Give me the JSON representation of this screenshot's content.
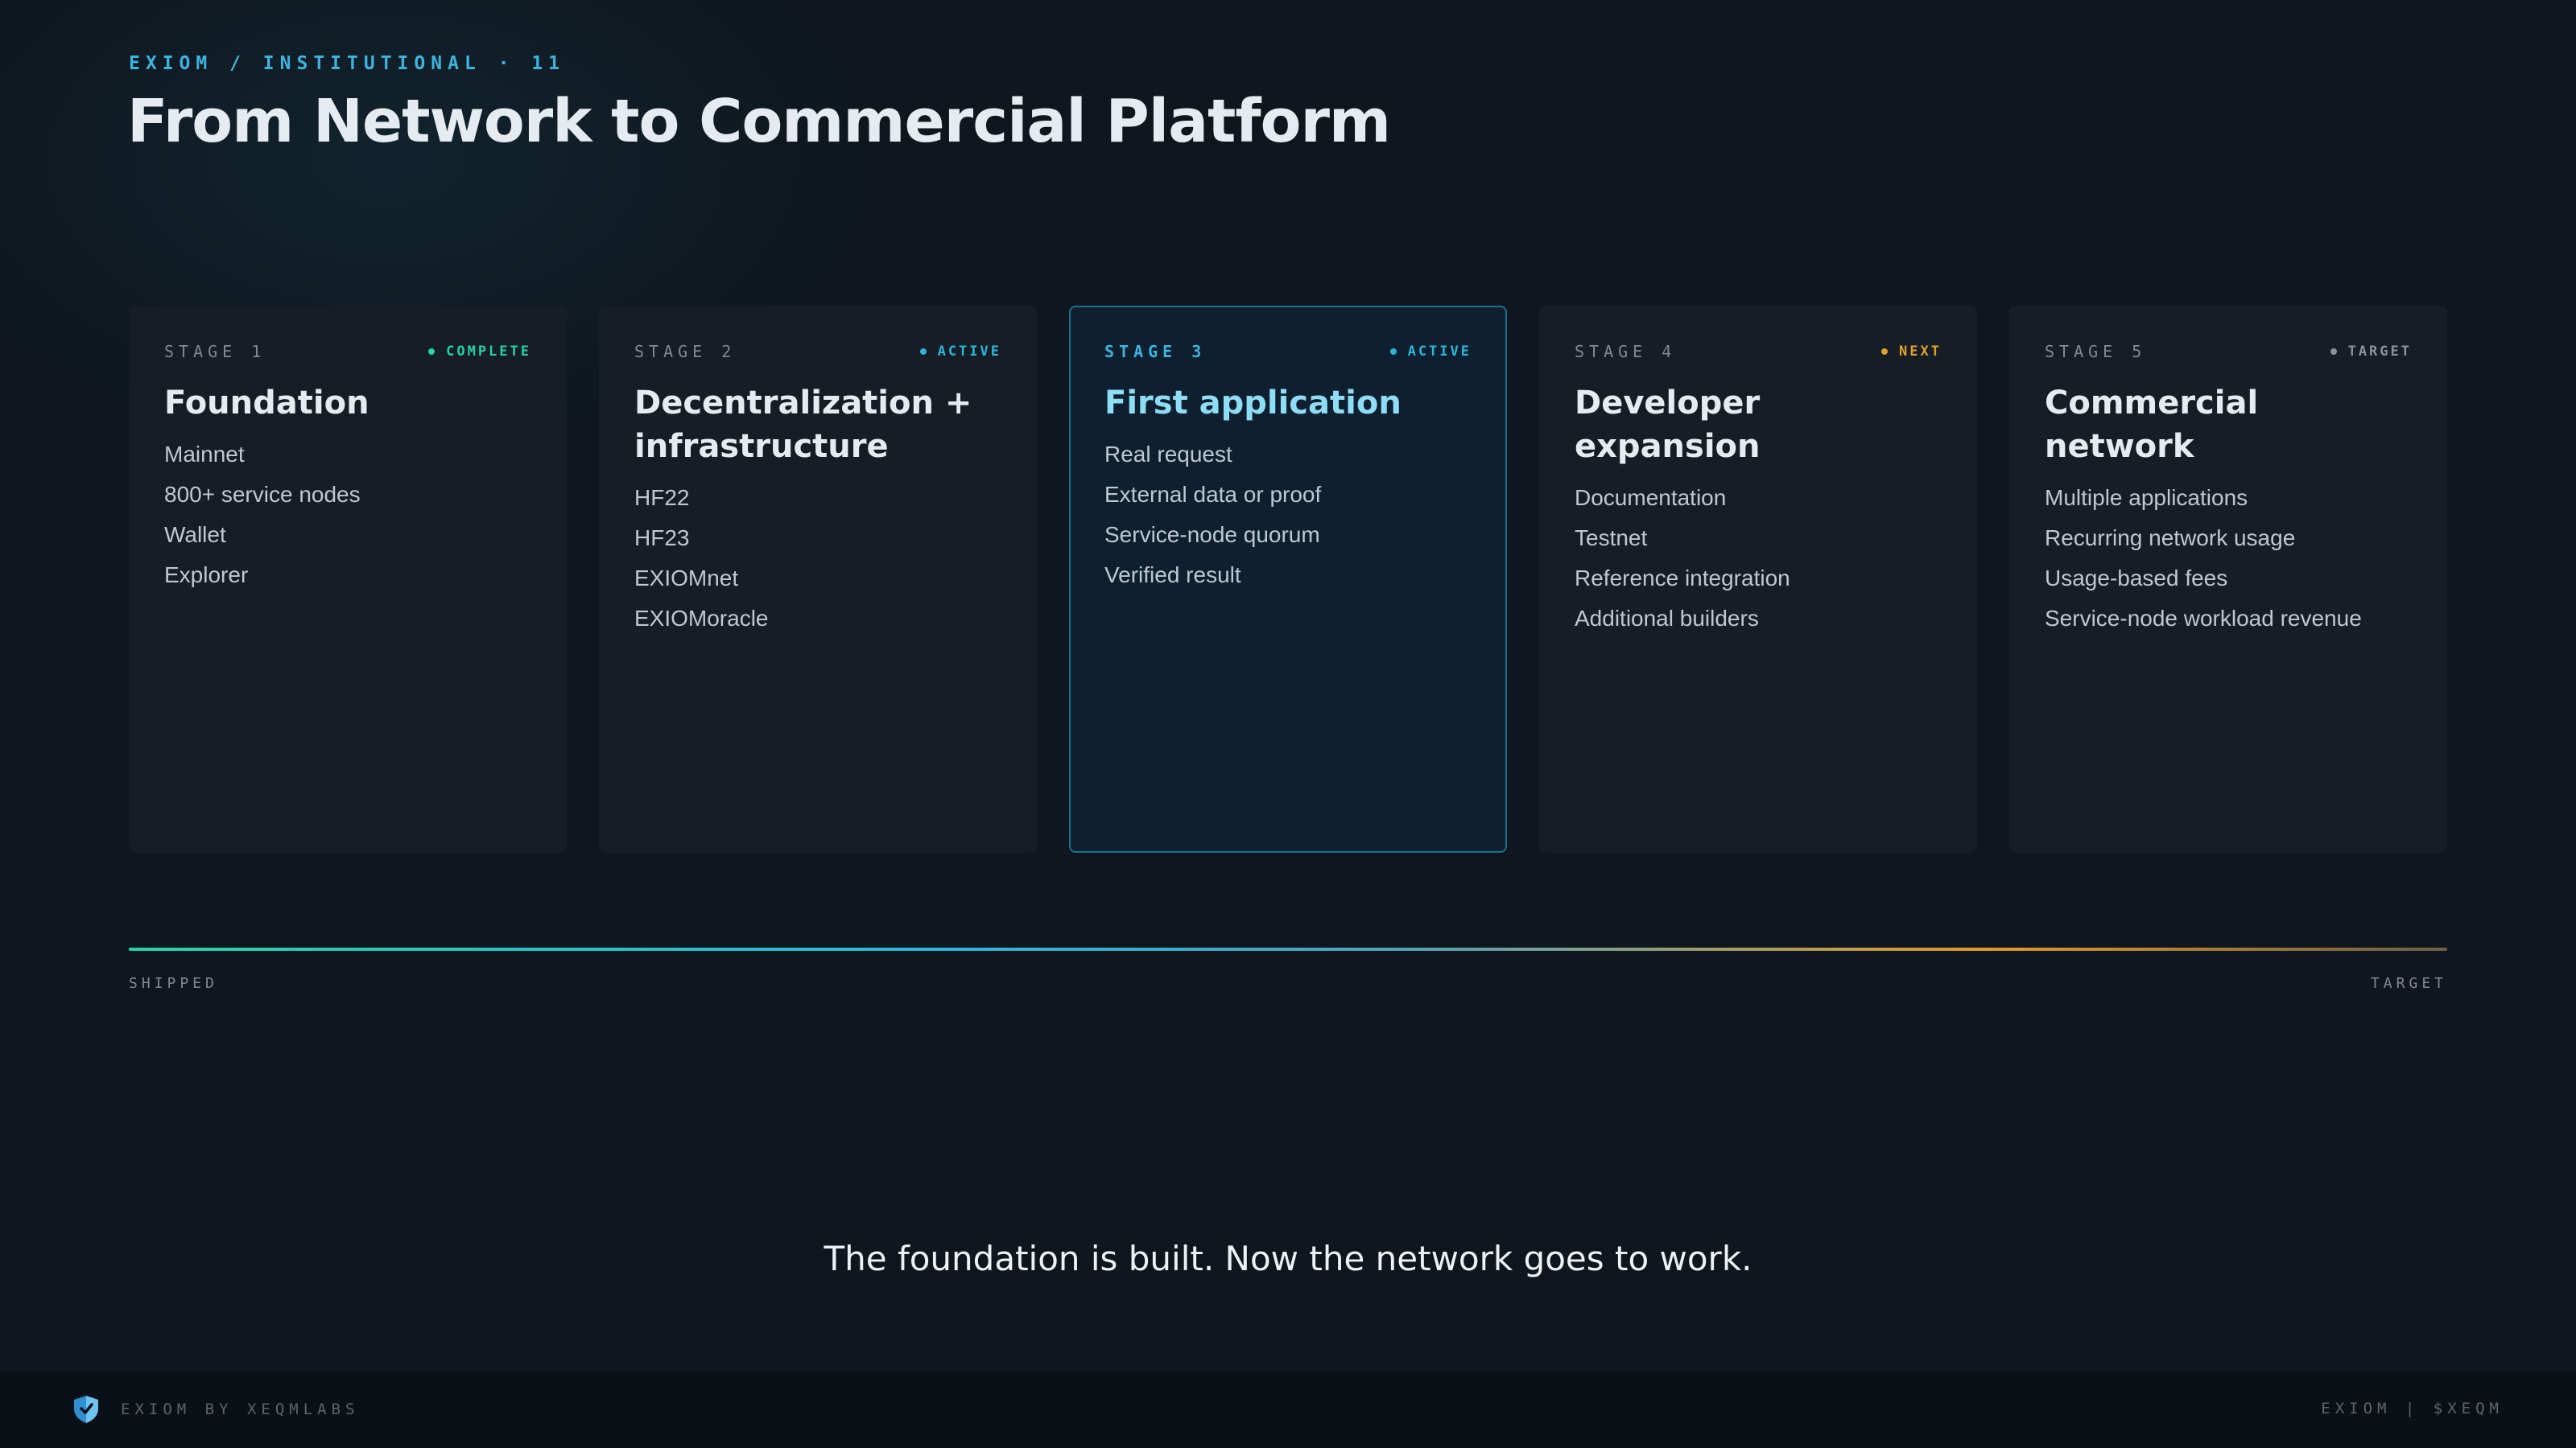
{
  "header": {
    "eyebrow": "EXIOM / INSTITUTIONAL · 11",
    "title": "From Network to Commercial Platform"
  },
  "stages": [
    {
      "label": "STAGE 1",
      "status": "COMPLETE",
      "status_color": "#22d3a6",
      "title": "Foundation",
      "items": [
        "Mainnet",
        "800+ service nodes",
        "Wallet",
        "Explorer"
      ]
    },
    {
      "label": "STAGE 2",
      "status": "ACTIVE",
      "status_color": "#2bb6dc",
      "title": "Decentralization + infrastructure",
      "items": [
        "HF22",
        "HF23",
        "EXIOMnet",
        "EXIOMoracle"
      ]
    },
    {
      "label": "STAGE 3",
      "status": "ACTIVE",
      "status_color": "#2bb6dc",
      "title": "First application",
      "items": [
        "Real request",
        "External data or proof",
        "Service-node quorum",
        "Verified result"
      ],
      "highlighted": true
    },
    {
      "label": "STAGE 4",
      "status": "NEXT",
      "status_color": "#e0a12c",
      "title": "Developer expansion",
      "items": [
        "Documentation",
        "Testnet",
        "Reference integration",
        "Additional builders"
      ]
    },
    {
      "label": "STAGE 5",
      "status": "TARGET",
      "status_color": "#8a939c",
      "title": "Commercial network",
      "items": [
        "Multiple applications",
        "Recurring network usage",
        "Usage-based fees",
        "Service-node workload revenue"
      ]
    }
  ],
  "progress": {
    "fraction": 1.0,
    "start_label": "SHIPPED",
    "end_label": "TARGET"
  },
  "tagline": "The foundation is built. Now the network goes to work.",
  "footer": {
    "brand_icon": "shield-icon",
    "brand_text": "EXIOM BY XEQMLABS",
    "right_text": "EXIOM | $XEQM"
  },
  "colors": {
    "accent": "#3fb3e0",
    "background": "#0f161d",
    "card": "#161d25",
    "highlight_border": "#1d6f93"
  }
}
